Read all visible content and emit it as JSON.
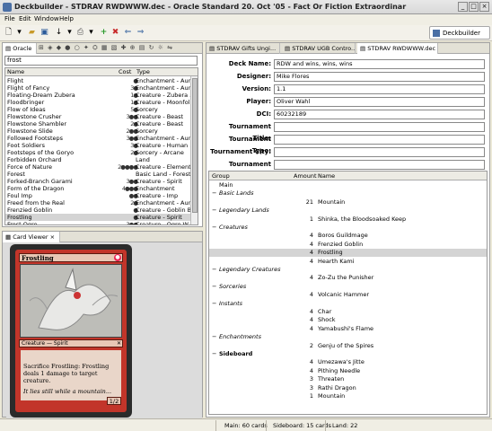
{
  "window": {
    "title": "Deckbuilder - STDRAV RWDWWW.dec - Oracle Standard 20. Oct '05 - Fact Or Fiction Extraordinar"
  },
  "menu": [
    "File",
    "Edit",
    "Window",
    "Help"
  ],
  "perspective": {
    "label": "Deckbuilder"
  },
  "oracle": {
    "tab_label": "Oracle",
    "search_value": "frost",
    "columns": [
      "Name",
      "Cost",
      "Type"
    ],
    "cards": [
      {
        "name": "Flight",
        "cost": "●",
        "type": "Enchantment - Aura"
      },
      {
        "name": "Flight of Fancy",
        "cost": "3●",
        "type": "Enchantment - Aura"
      },
      {
        "name": "Floating-Dream Zubera",
        "cost": "1●",
        "type": "Creature - Zubera ..."
      },
      {
        "name": "Floodbringer",
        "cost": "1●",
        "type": "Creature - Moonfol..."
      },
      {
        "name": "Flow of Ideas",
        "cost": "5●",
        "type": "Sorcery"
      },
      {
        "name": "Flowstone Crusher",
        "cost": "3●●",
        "type": "Creature - Beast"
      },
      {
        "name": "Flowstone Shambler",
        "cost": "2●",
        "type": "Creature - Beast"
      },
      {
        "name": "Flowstone Slide",
        "cost": "2●●",
        "type": "Sorcery"
      },
      {
        "name": "Followed Footsteps",
        "cost": "3●●",
        "type": "Enchantment - Aura"
      },
      {
        "name": "Foot Soldiers",
        "cost": "3●",
        "type": "Creature - Human ..."
      },
      {
        "name": "Footsteps of the Goryo",
        "cost": "2●",
        "type": "Sorcery - Arcane"
      },
      {
        "name": "Forbidden Orchard",
        "cost": "",
        "type": "Land"
      },
      {
        "name": "Force of Nature",
        "cost": "2●●●●",
        "type": "Creature - Elemental"
      },
      {
        "name": "Forest",
        "cost": "",
        "type": "Basic Land - Forest"
      },
      {
        "name": "Forked-Branch Garami",
        "cost": "3●●",
        "type": "Creature - Spirit"
      },
      {
        "name": "Form of the Dragon",
        "cost": "4●●●",
        "type": "Enchantment"
      },
      {
        "name": "Foul Imp",
        "cost": "●●",
        "type": "Creature - Imp"
      },
      {
        "name": "Freed from the Real",
        "cost": "2●",
        "type": "Enchantment - Aura"
      },
      {
        "name": "Frenzied Goblin",
        "cost": "●",
        "type": "Creature - Goblin B..."
      },
      {
        "name": "Frostling",
        "cost": "●",
        "type": "Creature - Spirit"
      },
      {
        "name": "Frost Ogre",
        "cost": "3●●",
        "type": "Creature - Ogre W..."
      }
    ],
    "selected_index": 19
  },
  "card_viewer": {
    "tab_label": "Card Viewer",
    "card": {
      "name": "Frostling",
      "type": "Creature — Spirit",
      "rules": "Sacrifice Frostling: Frostling deals 1 damage to target creature.",
      "flavor": "It lies still while a mountain...",
      "pt": "1/2"
    }
  },
  "editor_tabs": [
    "STDRAV Gifts Ungi...",
    "STDRAV UGB Contro...",
    "STDRAV RWDWWW.dec"
  ],
  "deck_info": {
    "fields": [
      {
        "label": "Deck Name:",
        "value": "RDW and wins, wins, wins"
      },
      {
        "label": "Designer:",
        "value": "Mike Flores"
      },
      {
        "label": "Version:",
        "value": "1.1"
      },
      {
        "label": "Player:",
        "value": "Oliver Wahl"
      },
      {
        "label": "DCI:",
        "value": "60232189"
      },
      {
        "label": "Tournament Title:",
        "value": ""
      },
      {
        "label": "Tournament Type:",
        "value": ""
      },
      {
        "label": "Tournament City:",
        "value": ""
      },
      {
        "label": "Tournament Date:",
        "value": ""
      }
    ]
  },
  "decklist": {
    "columns": [
      "Group",
      "Amount",
      "Name"
    ],
    "rows": [
      {
        "group": "Main",
        "style": "plain",
        "amount": "",
        "name": "",
        "expand": ""
      },
      {
        "group": "Basic Lands",
        "style": "italic",
        "amount": "",
        "name": "",
        "expand": "−"
      },
      {
        "group": "",
        "style": "plain",
        "amount": "21",
        "name": "Mountain",
        "expand": ""
      },
      {
        "group": "Legendary Lands",
        "style": "italic",
        "amount": "",
        "name": "",
        "expand": "−"
      },
      {
        "group": "",
        "style": "plain",
        "amount": "1",
        "name": "Shinka, the Bloodsoaked Keep",
        "expand": ""
      },
      {
        "group": "Creatures",
        "style": "italic",
        "amount": "",
        "name": "",
        "expand": "−"
      },
      {
        "group": "",
        "style": "plain",
        "amount": "4",
        "name": "Boros Guildmage",
        "expand": ""
      },
      {
        "group": "",
        "style": "plain",
        "amount": "4",
        "name": "Frenzied Goblin",
        "expand": ""
      },
      {
        "group": "",
        "style": "plain",
        "amount": "4",
        "name": "Frostling",
        "expand": ""
      },
      {
        "group": "",
        "style": "plain",
        "amount": "4",
        "name": "Hearth Kami",
        "expand": ""
      },
      {
        "group": "Legendary Creatures",
        "style": "italic",
        "amount": "",
        "name": "",
        "expand": "−"
      },
      {
        "group": "",
        "style": "plain",
        "amount": "4",
        "name": "Zo-Zu the Punisher",
        "expand": ""
      },
      {
        "group": "Sorceries",
        "style": "italic",
        "amount": "",
        "name": "",
        "expand": "−"
      },
      {
        "group": "",
        "style": "plain",
        "amount": "4",
        "name": "Volcanic Hammer",
        "expand": ""
      },
      {
        "group": "Instants",
        "style": "italic",
        "amount": "",
        "name": "",
        "expand": "−"
      },
      {
        "group": "",
        "style": "plain",
        "amount": "4",
        "name": "Char",
        "expand": ""
      },
      {
        "group": "",
        "style": "plain",
        "amount": "4",
        "name": "Shock",
        "expand": ""
      },
      {
        "group": "",
        "style": "plain",
        "amount": "4",
        "name": "Yamabushi's Flame",
        "expand": ""
      },
      {
        "group": "Enchantments",
        "style": "italic",
        "amount": "",
        "name": "",
        "expand": "−"
      },
      {
        "group": "",
        "style": "plain",
        "amount": "2",
        "name": "Genju of the Spires",
        "expand": ""
      },
      {
        "group": "Sideboard",
        "style": "bold",
        "amount": "",
        "name": "",
        "expand": "−"
      },
      {
        "group": "",
        "style": "plain",
        "amount": "4",
        "name": "Umezawa's Jitte",
        "expand": ""
      },
      {
        "group": "",
        "style": "plain",
        "amount": "4",
        "name": "Pithing Needle",
        "expand": ""
      },
      {
        "group": "",
        "style": "plain",
        "amount": "3",
        "name": "Threaten",
        "expand": ""
      },
      {
        "group": "",
        "style": "plain",
        "amount": "3",
        "name": "Rathi Dragon",
        "expand": ""
      },
      {
        "group": "",
        "style": "plain",
        "amount": "1",
        "name": "Mountain",
        "expand": ""
      }
    ],
    "selected_index": 8
  },
  "status": {
    "main": "Main: 60 cards",
    "sideboard": "Sideboard: 15 cards",
    "land": "Land: 22"
  },
  "colors": {
    "selection": "#d4d4d4",
    "card_red": "#c2352a"
  }
}
